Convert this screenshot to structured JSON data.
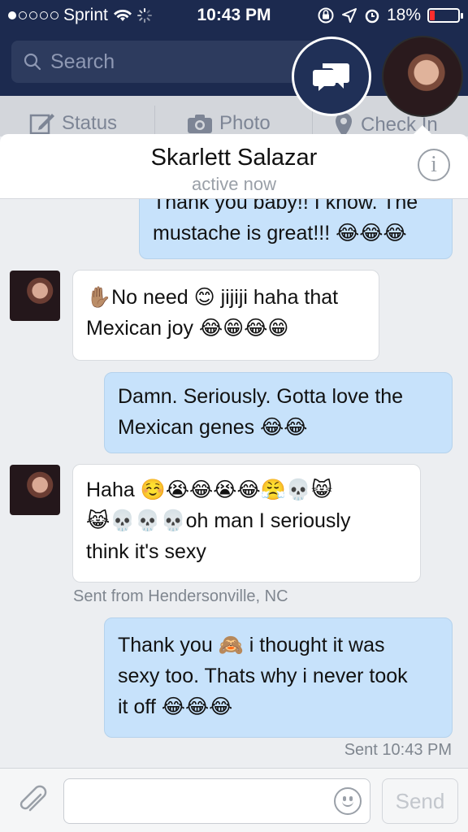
{
  "status_bar": {
    "carrier": "Sprint",
    "time": "10:43 PM",
    "battery_percent": "18%",
    "battery_level": 0.18,
    "signal_bars_filled": 1,
    "signal_bars_total": 5
  },
  "header": {
    "search_placeholder": "Search",
    "actions": [
      {
        "label": "Status",
        "icon": "pencil-square-icon"
      },
      {
        "label": "Photo",
        "icon": "camera-icon"
      },
      {
        "label": "Check In",
        "icon": "location-pin-icon"
      }
    ]
  },
  "chat": {
    "contact_name": "Skarlett Salazar",
    "presence": "active now",
    "messages": [
      {
        "direction": "out",
        "lines": [
          "Thank you baby!! I know. The",
          "mustache is great!!! 😂😂😂"
        ]
      },
      {
        "direction": "in",
        "lines": [
          "✋🏽No need 😊 jijiji haha that",
          "Mexican joy 😂😁😂😁"
        ]
      },
      {
        "direction": "out",
        "lines": [
          "Damn. Seriously. Gotta love the",
          "Mexican genes 😂😂"
        ]
      },
      {
        "direction": "in",
        "lines": [
          "Haha ☺️😭😂😭😂😤💀😸",
          "😹💀💀💀oh man I seriously",
          "think it's sexy"
        ],
        "meta": "Sent from Hendersonville, NC"
      },
      {
        "direction": "out",
        "lines": [
          "Thank you 🙈 i thought it was",
          "sexy too. Thats why i never took",
          "it off 😂😂😂"
        ],
        "meta": "Sent 10:43 PM"
      }
    ]
  },
  "compose": {
    "send_label": "Send"
  },
  "colors": {
    "topbar": "#1c2a4f",
    "outgoing_bubble": "#c7e2fb",
    "incoming_bubble": "#ffffff"
  }
}
